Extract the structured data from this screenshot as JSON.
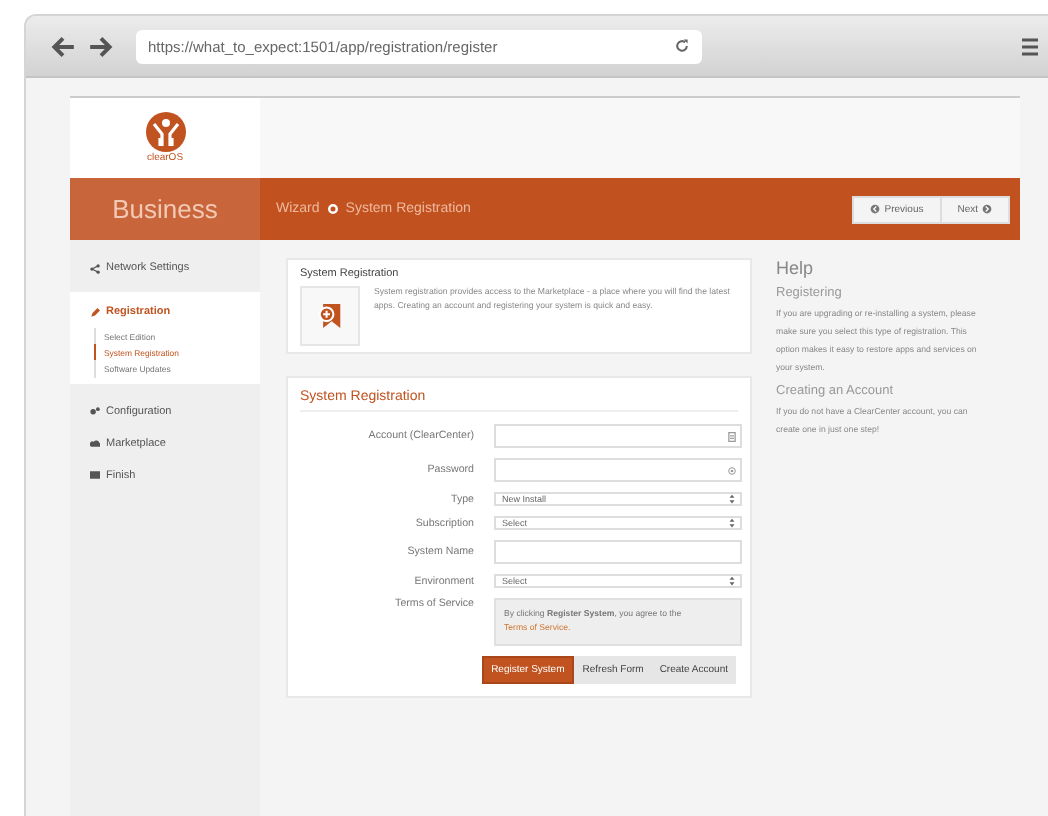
{
  "browser": {
    "url": "https://what_to_expect:1501/app/registration/register"
  },
  "logo": {
    "text": "clearOS"
  },
  "header": {
    "edition": "Business",
    "breadcrumb": [
      "Wizard",
      "System Registration"
    ],
    "buttons": [
      {
        "label": "Previous"
      },
      {
        "label": "Next"
      }
    ]
  },
  "sidebar": {
    "items": [
      {
        "label": "Network Settings",
        "selected": false,
        "expanded": false
      },
      {
        "label": "Registration",
        "selected": true,
        "expanded": true,
        "children": [
          {
            "label": "Select Edition",
            "selected": false
          },
          {
            "label": "System Registration",
            "selected": true
          },
          {
            "label": "Software Updates",
            "selected": false
          }
        ]
      },
      {
        "label": "Configuration",
        "selected": false,
        "expanded": false
      },
      {
        "label": "Marketplace",
        "selected": false,
        "expanded": false
      },
      {
        "label": "Finish",
        "selected": false,
        "expanded": false
      }
    ]
  },
  "intro": {
    "title": "System Registration",
    "text": "System registration provides access to the Marketplace - a place where you will find the latest apps. Creating an account and registering your system is quick and easy."
  },
  "form": {
    "title": "System Registration",
    "fields": [
      {
        "label": "Account (ClearCenter)",
        "kind": "text"
      },
      {
        "label": "Password",
        "kind": "text"
      },
      {
        "label": "Type",
        "kind": "select",
        "value": "New Install"
      },
      {
        "label": "Subscription",
        "kind": "select",
        "value": "Select"
      },
      {
        "label": "System Name",
        "kind": "text"
      },
      {
        "label": "Environment",
        "kind": "select",
        "value": "Select"
      }
    ],
    "terms": {
      "label": "Terms of Service",
      "text": "By clicking **Register System**, you agree to the",
      "link": "Terms of Service."
    },
    "buttons": [
      {
        "label": "Register System",
        "primary": true
      },
      {
        "label": "Refresh Form",
        "primary": false
      },
      {
        "label": "Create Account",
        "primary": false
      }
    ]
  },
  "help": {
    "title": "Help",
    "sections": [
      {
        "heading": "Registering",
        "text": "If you are upgrading or re-installing a system, please make sure you select this type of registration. This option makes it easy to restore apps and services on your system."
      },
      {
        "heading": "Creating an Account",
        "text": "If you do not have a ClearCenter account, you can create one in just one step!"
      }
    ]
  }
}
